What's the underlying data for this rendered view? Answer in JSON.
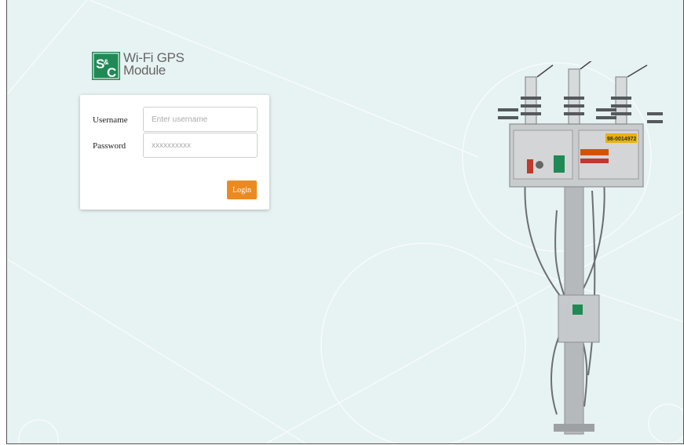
{
  "brand": {
    "logo_letters": "S&C",
    "title_line1": "Wi-Fi GPS",
    "title_line2": "Module",
    "logo_color": "#1f8a55"
  },
  "login_form": {
    "username_label": "Username",
    "username_placeholder": "Enter username",
    "password_label": "Password",
    "password_placeholder": "xxxxxxxxxx",
    "login_label": "Login",
    "accent_color": "#ec8a1f"
  },
  "product": {
    "serial_label": "98-0014972"
  },
  "theme": {
    "background": "#e7f2f2"
  }
}
